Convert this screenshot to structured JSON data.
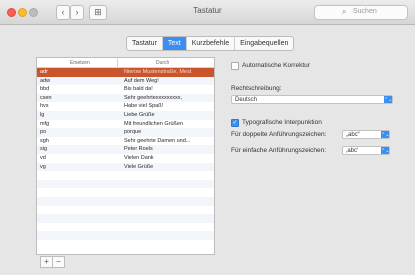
{
  "window": {
    "title": "Tastatur",
    "nav_back": "‹",
    "nav_forward": "›",
    "nav_grid": "⊞",
    "search_placeholder": "Suchen"
  },
  "tabs": [
    {
      "label": "Tastatur",
      "active": false
    },
    {
      "label": "Text",
      "active": true
    },
    {
      "label": "Kurzbefehle",
      "active": false
    },
    {
      "label": "Eingabequellen",
      "active": false
    }
  ],
  "table": {
    "col1_header": "Ersetzen",
    "col2_header": "Durch",
    "rows": [
      {
        "replace": "adr",
        "with": "Nierow Mustenstraße, Mest",
        "selected": true
      },
      {
        "replace": "adw",
        "with": "Auf dem Weg!",
        "selected": false
      },
      {
        "replace": "bbd",
        "with": "Bis bald da!",
        "selected": false
      },
      {
        "replace": "csen",
        "with": "Sehr geehrtexxxxxxxxx,",
        "selected": false
      },
      {
        "replace": "hvs",
        "with": "Habe viel Spaß!",
        "selected": false
      },
      {
        "replace": "lg",
        "with": "Liebe Grüße",
        "selected": false
      },
      {
        "replace": "mfg",
        "with": "Mit freundlichen Grüßen",
        "selected": false
      },
      {
        "replace": "po",
        "with": "porque",
        "selected": false
      },
      {
        "replace": "sgh",
        "with": "Sehr geehrte Damen und...",
        "selected": false
      },
      {
        "replace": "sig",
        "with": "Peter Roels",
        "selected": false
      },
      {
        "replace": "vd",
        "with": "Vielen Dank",
        "selected": false
      },
      {
        "replace": "vg",
        "with": "Viele Grüße",
        "selected": false
      },
      {
        "replace": "",
        "with": "",
        "selected": false
      },
      {
        "replace": "",
        "with": "",
        "selected": false
      },
      {
        "replace": "",
        "with": "",
        "selected": false
      },
      {
        "replace": "",
        "with": "",
        "selected": false
      },
      {
        "replace": "",
        "with": "",
        "selected": false
      },
      {
        "replace": "",
        "with": "",
        "selected": false
      },
      {
        "replace": "",
        "with": "",
        "selected": false
      },
      {
        "replace": "",
        "with": "",
        "selected": false
      },
      {
        "replace": "",
        "with": "",
        "selected": false
      }
    ],
    "add_label": "+",
    "remove_label": "−"
  },
  "options": {
    "auto_correct_label": "Automatische Korrektur",
    "auto_correct_checked": false,
    "spelling_label": "Rechtschreibung:",
    "spelling_value": "Deutsch",
    "smart_quotes_label": "Typografische Interpunktion",
    "smart_quotes_checked": true,
    "double_quotes_label": "Für doppelte Anführungszeichen:",
    "double_quotes_value": "„abc“",
    "single_quotes_label": "Für einfache Anführungszeichen:",
    "single_quotes_value": "‚abc‘",
    "checkmark": "✓",
    "popup_arrow": "⌃⌄"
  },
  "colors": {
    "accent": "#3b8ff2",
    "selected_row": "#c9552d"
  }
}
